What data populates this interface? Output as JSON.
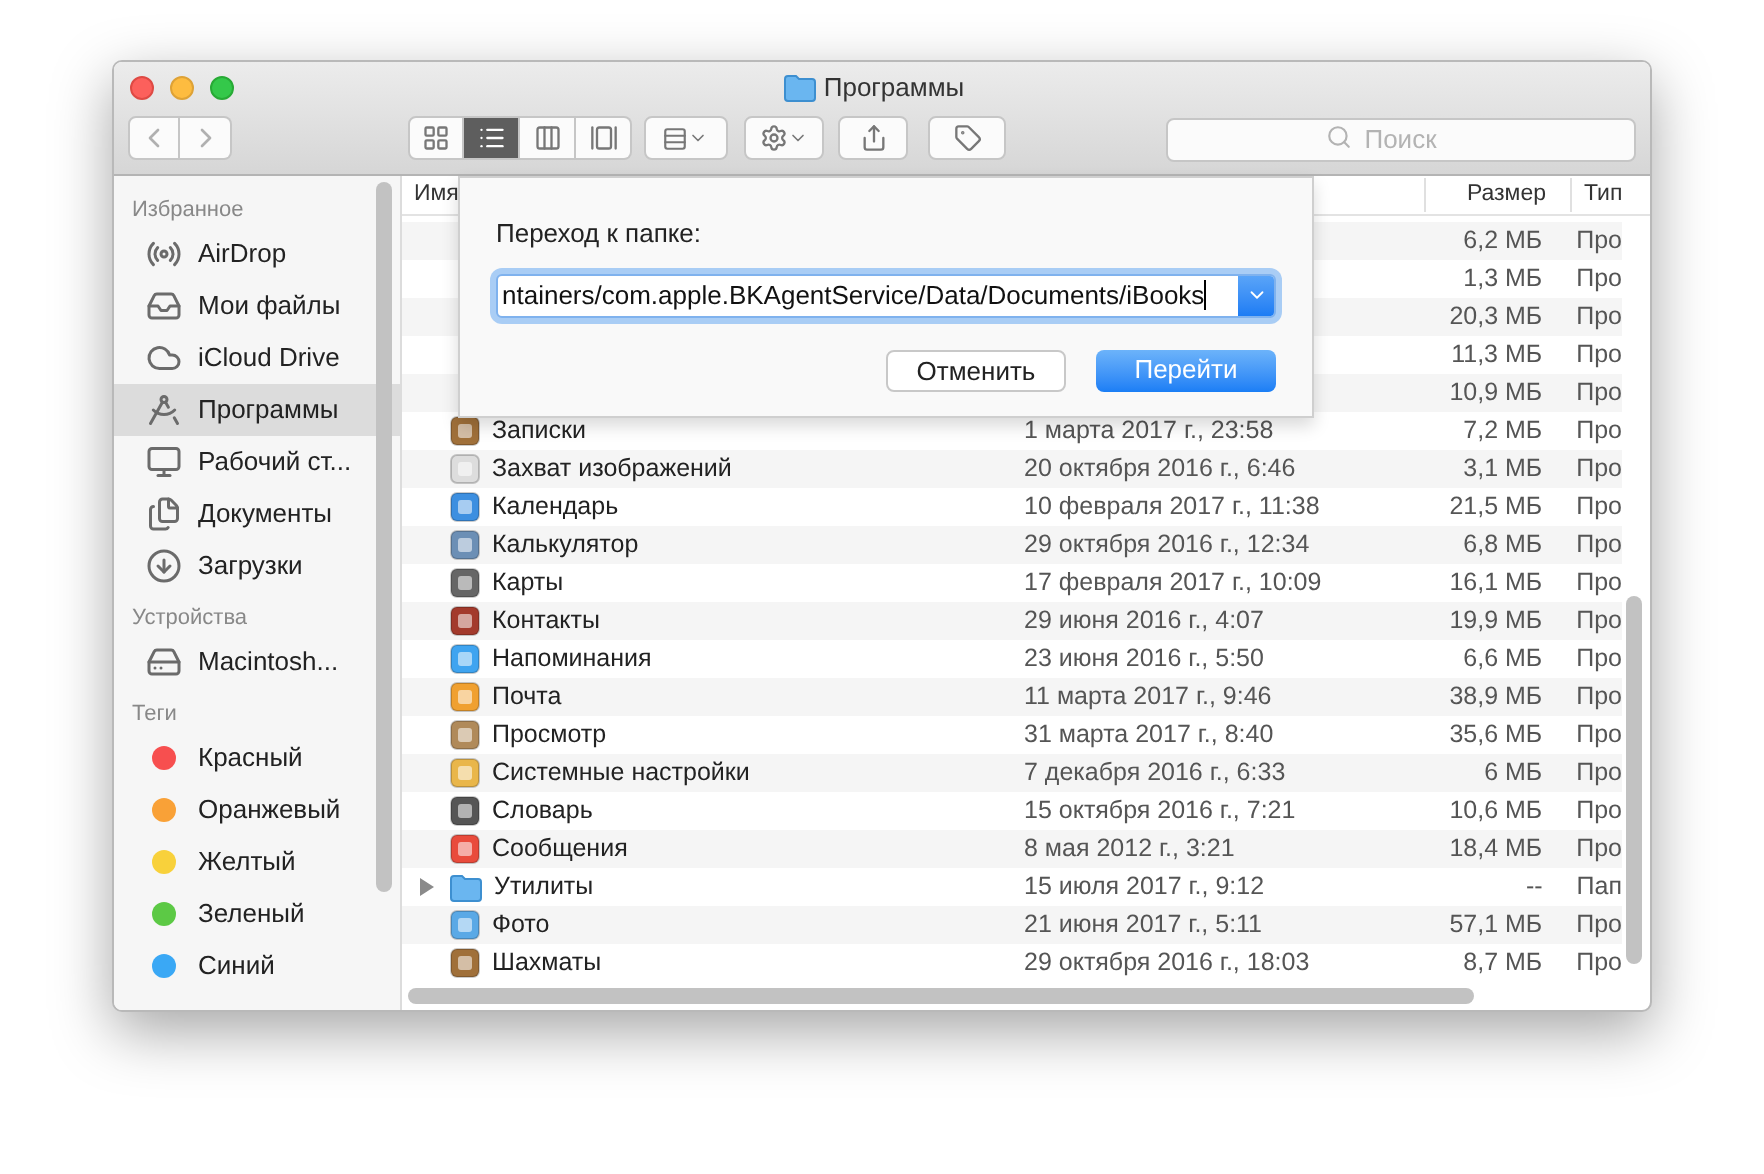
{
  "window": {
    "title": "Программы"
  },
  "toolbar": {
    "views": [
      {
        "kind": "icons",
        "selected": false
      },
      {
        "kind": "list",
        "selected": true
      },
      {
        "kind": "columns",
        "selected": false
      },
      {
        "kind": "cover_flow",
        "selected": false
      }
    ]
  },
  "search": {
    "placeholder": "Поиск"
  },
  "sidebar": {
    "sections": [
      {
        "title": "Избранное",
        "items": [
          {
            "label": "AirDrop",
            "kind": "airdrop",
            "selected": false
          },
          {
            "label": "Мои файлы",
            "kind": "files",
            "selected": false
          },
          {
            "label": "iCloud Drive",
            "kind": "cloud",
            "selected": false
          },
          {
            "label": "Программы",
            "kind": "apps",
            "selected": true
          },
          {
            "label": "Рабочий ст...",
            "kind": "desktop",
            "selected": false
          },
          {
            "label": "Документы",
            "kind": "documents",
            "selected": false
          },
          {
            "label": "Загрузки",
            "kind": "downloads",
            "selected": false
          }
        ]
      },
      {
        "title": "Устройства",
        "items": [
          {
            "label": "Macintosh...",
            "kind": "disk",
            "selected": false
          }
        ]
      },
      {
        "title": "Теги",
        "items": [
          {
            "label": "Красный",
            "kind": "tag",
            "color": "#f74f4f",
            "selected": false
          },
          {
            "label": "Оранжевый",
            "kind": "tag",
            "color": "#f9a137",
            "selected": false
          },
          {
            "label": "Желтый",
            "kind": "tag",
            "color": "#f8d13b",
            "selected": false
          },
          {
            "label": "Зеленый",
            "kind": "tag",
            "color": "#5cc945",
            "selected": false
          },
          {
            "label": "Синий",
            "kind": "tag",
            "color": "#3aa8f5",
            "selected": false
          }
        ]
      }
    ]
  },
  "table": {
    "columns": [
      "Имя",
      "Размер",
      "Тип"
    ],
    "rows": [
      {
        "size": "6,2 МБ",
        "type": "Про"
      },
      {
        "size": "1,3 МБ",
        "type": "Про"
      },
      {
        "size": "20,3 МБ",
        "type": "Про"
      },
      {
        "size": "11,3 МБ",
        "type": "Про"
      },
      {
        "size": "10,9 МБ",
        "type": "Про"
      },
      {
        "kind": "app",
        "name": "Записки",
        "date": "1 марта 2017 г., 23:58",
        "size": "7,2 МБ",
        "type": "Про"
      },
      {
        "kind": "app",
        "name": "Захват изображений",
        "date": "20 октября 2016 г., 6:46",
        "size": "3,1 МБ",
        "type": "Про"
      },
      {
        "kind": "app",
        "name": "Календарь",
        "date": "10 февраля 2017 г., 11:38",
        "size": "21,5 МБ",
        "type": "Про"
      },
      {
        "kind": "app",
        "name": "Калькулятор",
        "date": "29 октября 2016 г., 12:34",
        "size": "6,8 МБ",
        "type": "Про"
      },
      {
        "kind": "app",
        "name": "Карты",
        "date": "17 февраля 2017 г., 10:09",
        "size": "16,1 МБ",
        "type": "Про"
      },
      {
        "kind": "app",
        "name": "Контакты",
        "date": "29 июня 2016 г., 4:07",
        "size": "19,9 МБ",
        "type": "Про"
      },
      {
        "kind": "app",
        "name": "Напоминания",
        "date": "23 июня 2016 г., 5:50",
        "size": "6,6 МБ",
        "type": "Про"
      },
      {
        "kind": "app",
        "name": "Почта",
        "date": "11 марта 2017 г., 9:46",
        "size": "38,9 МБ",
        "type": "Про"
      },
      {
        "kind": "app",
        "name": "Просмотр",
        "date": "31 марта 2017 г., 8:40",
        "size": "35,6 МБ",
        "type": "Про"
      },
      {
        "kind": "app",
        "name": "Системные настройки",
        "date": "7 декабря 2016 г., 6:33",
        "size": "6 МБ",
        "type": "Про"
      },
      {
        "kind": "app",
        "name": "Словарь",
        "date": "15 октября 2016 г., 7:21",
        "size": "10,6 МБ",
        "type": "Про"
      },
      {
        "kind": "app",
        "name": "Сообщения",
        "date": "8 мая 2012 г., 3:21",
        "size": "18,4 МБ",
        "type": "Про"
      },
      {
        "kind": "folder",
        "expanded": false,
        "name": "Утилиты",
        "date": "15 июля 2017 г., 9:12",
        "size": "--",
        "type": "Пап"
      },
      {
        "kind": "app",
        "name": "Фото",
        "date": "21 июня 2017 г., 5:11",
        "size": "57,1 МБ",
        "type": "Про"
      },
      {
        "kind": "app",
        "name": "Шахматы",
        "date": "29 октября 2016 г., 18:03",
        "size": "8,7 МБ",
        "type": "Про"
      }
    ]
  },
  "dialog": {
    "title": "Переход к папке:",
    "path": "ntainers/com.apple.BKAgentService/Data/Documents/iBooks",
    "buttons": [
      {
        "label": "Отменить",
        "kind": "secondary"
      },
      {
        "label": "Перейти",
        "kind": "primary"
      }
    ]
  }
}
